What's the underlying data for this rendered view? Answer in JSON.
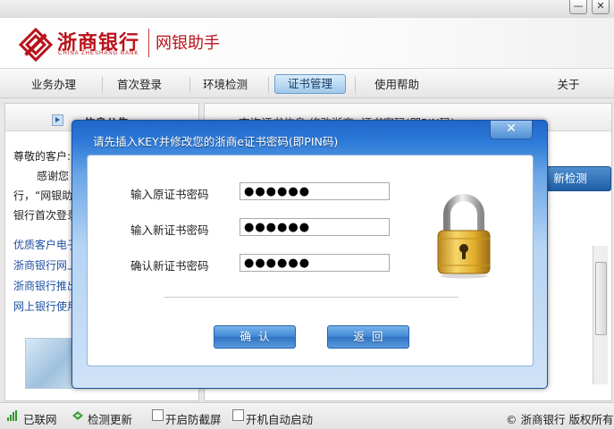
{
  "window": {
    "minimize_label": "—",
    "close_label": "✕"
  },
  "header": {
    "brand_cn": "浙商银行",
    "brand_en": "CHINA ZHESHANG BANK",
    "app_name": "网银助手",
    "brand_color": "#b9121b"
  },
  "nav": {
    "items": [
      {
        "label": "业务办理"
      },
      {
        "label": "首次登录"
      },
      {
        "label": "环境检测"
      },
      {
        "label": "证书管理",
        "active": true
      },
      {
        "label": "使用帮助"
      },
      {
        "label": "关于"
      }
    ]
  },
  "left_panel": {
    "title": "信息公告",
    "greeting": "尊敬的客户:",
    "lines": [
      "感谢您",
      "行，“网银助",
      "银行首次登录"
    ],
    "links": [
      "优质客户电子",
      "浙商银行网上",
      "浙商银行推出",
      "网上银行使用"
    ]
  },
  "right_panel": {
    "tab_text": "查询证书信息  修改浙商e证书密码(即PIN码)",
    "detect_button": "新检测"
  },
  "footer": {
    "connected": "已联网",
    "check_update": "检测更新",
    "enable_screen_protect": "开启防截屏",
    "auto_start": "开机自动启动",
    "copyright": "© 浙商银行 版权所有"
  },
  "dialog": {
    "title": "请先插入KEY并修改您的浙商e证书密码(即PIN码)",
    "close_label": "✕",
    "fields": [
      {
        "label": "输入原证书密码",
        "value": "●●●●●●"
      },
      {
        "label": "输入新证书密码",
        "value": "●●●●●●"
      },
      {
        "label": "确认新证书密码",
        "value": "●●●●●●"
      }
    ],
    "confirm_label": "确认",
    "back_label": "返回",
    "icon": "padlock-icon"
  }
}
